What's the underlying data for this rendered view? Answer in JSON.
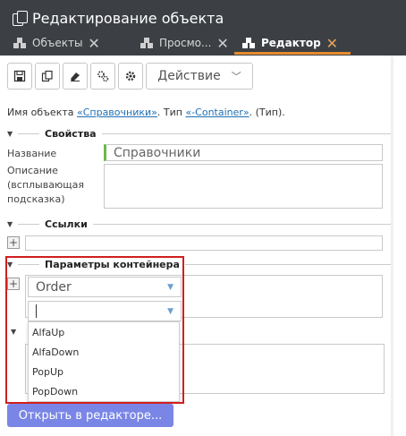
{
  "window": {
    "title": "Редактирование объекта"
  },
  "tabs": [
    {
      "label": "Объекты",
      "icon": "cubes-icon",
      "active": false
    },
    {
      "label": "Просмо...",
      "icon": "cubes-icon",
      "active": false
    },
    {
      "label": "Редактор",
      "icon": "cubes-icon",
      "active": true
    }
  ],
  "toolbar": {
    "buttons": [
      "save-icon",
      "copy-icon",
      "eraser-icon",
      "gears-icon",
      "gear-icon"
    ],
    "action_label": "Действие"
  },
  "info": {
    "prefix": "Имя объекта ",
    "name_link": "«Справочники»",
    "mid": ". Тип ",
    "type_link": "«-Container»",
    "suffix": ". (Тип)."
  },
  "sections": {
    "properties": "Свойства",
    "links": "Ссылки",
    "container_params": "Параметры контейнера"
  },
  "fields": {
    "name_label": "Название",
    "name_value": "Справочники",
    "desc_label_1": "Описание",
    "desc_label_2": "(всплывающая",
    "desc_label_3": "подсказка)",
    "desc_value": ""
  },
  "container": {
    "order_select": "Order",
    "second_select": "",
    "dropdown_options": [
      "AlfaUp",
      "AlfaDown",
      "PopUp",
      "PopDown"
    ]
  },
  "footer": {
    "open_editor_label": "Открыть в редакторе..."
  },
  "colors": {
    "titlebar": "#3c4044",
    "active_tab_accent": "#e68a2e",
    "highlight_frame": "#d11f1f",
    "primary_button": "#7a86e6",
    "link": "#1f6fb5"
  }
}
